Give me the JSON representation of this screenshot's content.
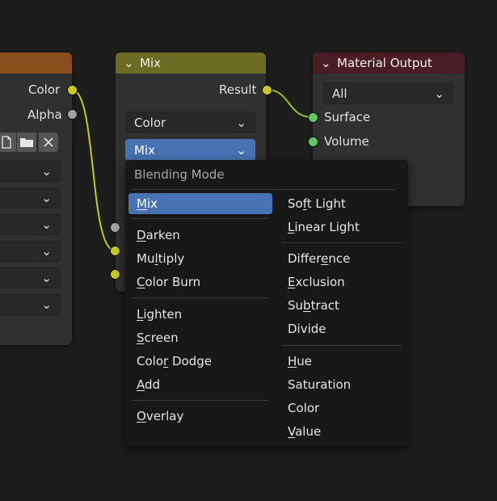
{
  "left_node": {
    "outputs": [
      "Color",
      "Alpha"
    ],
    "header_color": "#8a4e1c",
    "toolbar_icons": [
      "new-image-icon",
      "open-folder-icon",
      "close-icon"
    ],
    "dropdown_count": 6
  },
  "mix_node": {
    "title": "Mix",
    "output": "Result",
    "data_type": "Color",
    "blend_mode": "Mix",
    "header_color": "#6b6b24"
  },
  "output_node": {
    "title": "Material Output",
    "target": "All",
    "inputs": [
      "Surface",
      "Volume"
    ],
    "header_color": "#4a1c25"
  },
  "blend_menu": {
    "title": "Blending Mode",
    "selected": "Mix",
    "left_column": [
      "Mix",
      "Darken",
      "Multiply",
      "Color Burn",
      "Lighten",
      "Screen",
      "Color Dodge",
      "Add",
      "Overlay"
    ],
    "right_column": [
      "Soft Light",
      "Linear Light",
      "Difference",
      "Exclusion",
      "Subtract",
      "Divide",
      "Hue",
      "Saturation",
      "Color",
      "Value"
    ]
  }
}
